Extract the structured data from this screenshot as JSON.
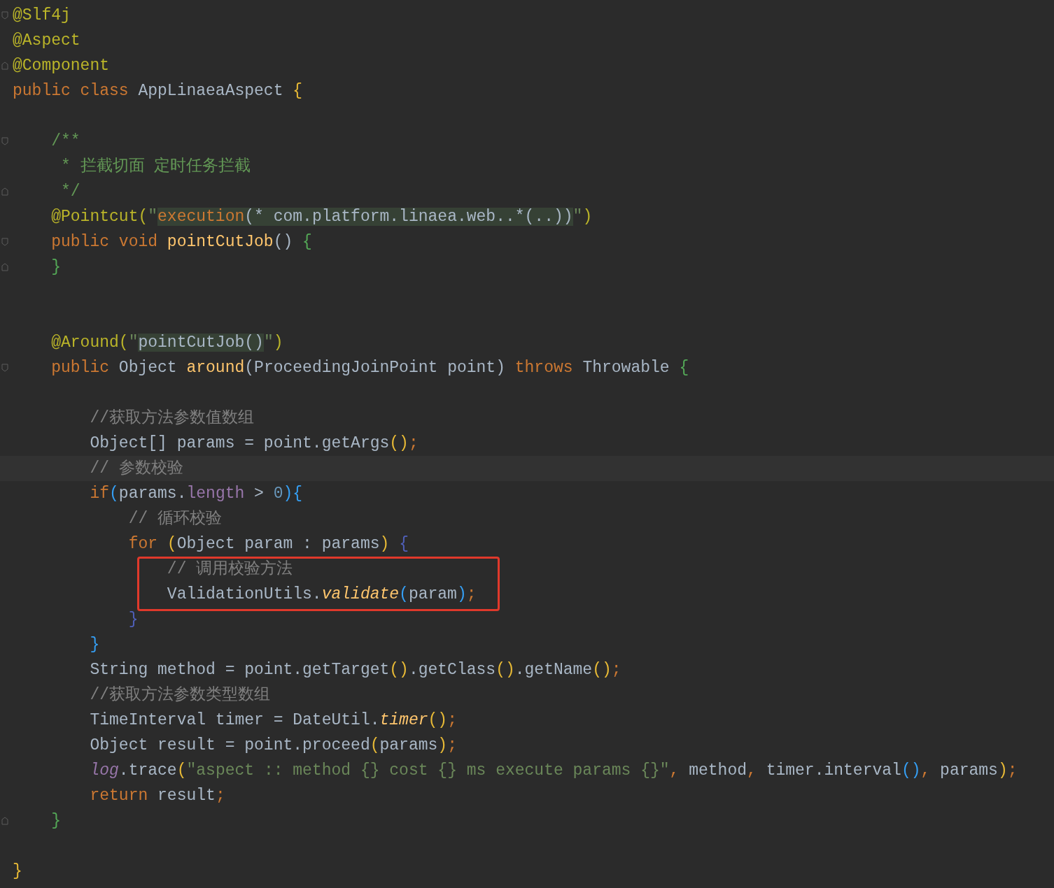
{
  "editor": {
    "lines": [
      {
        "kind": "code",
        "fold_start": true,
        "tokens": [
          {
            "text": "@Slf4j",
            "kind": "annotation"
          }
        ]
      },
      {
        "kind": "code",
        "tokens": [
          {
            "text": "@Aspect",
            "kind": "annotation"
          }
        ]
      },
      {
        "kind": "code",
        "fold_end": true,
        "tokens": [
          {
            "text": "@Component",
            "kind": "annotation"
          }
        ]
      },
      {
        "kind": "code",
        "tokens": [
          {
            "text": "public class ",
            "kind": "keyword"
          },
          {
            "text": "AppLinaeaAspect ",
            "kind": "plain"
          },
          {
            "text": "{",
            "kind": "b1"
          }
        ]
      },
      {
        "kind": "blank"
      },
      {
        "kind": "code",
        "fold_start": true,
        "tokens": [
          {
            "text": "    /**",
            "kind": "doc"
          }
        ]
      },
      {
        "kind": "code",
        "tokens": [
          {
            "text": "     * 拦截切面 定时任务拦截",
            "kind": "doc"
          }
        ]
      },
      {
        "kind": "code",
        "fold_end": true,
        "tokens": [
          {
            "text": "     */",
            "kind": "doc"
          }
        ]
      },
      {
        "kind": "code",
        "tokens": [
          {
            "text": "    @Pointcut(",
            "kind": "annotation"
          },
          {
            "text": "\"",
            "kind": "string"
          },
          {
            "text": "execution",
            "kind": "injected_keyword"
          },
          {
            "text": "(* com.platform.linaea.web..*(..))",
            "kind": "injected"
          },
          {
            "text": "\"",
            "kind": "string"
          },
          {
            "text": ")",
            "kind": "annotation"
          }
        ]
      },
      {
        "kind": "code",
        "fold_start": true,
        "tokens": [
          {
            "text": "    public void ",
            "kind": "keyword"
          },
          {
            "text": "pointCutJob",
            "kind": "declaration"
          },
          {
            "text": "() ",
            "kind": "plain"
          },
          {
            "text": "{",
            "kind": "b2"
          }
        ]
      },
      {
        "kind": "code",
        "fold_end": true,
        "tokens": [
          {
            "text": "    }",
            "kind": "b2"
          }
        ]
      },
      {
        "kind": "blank"
      },
      {
        "kind": "blank"
      },
      {
        "kind": "code",
        "tokens": [
          {
            "text": "    @Around(",
            "kind": "annotation"
          },
          {
            "text": "\"",
            "kind": "string"
          },
          {
            "text": "pointCutJob()",
            "kind": "injected"
          },
          {
            "text": "\"",
            "kind": "string"
          },
          {
            "text": ")",
            "kind": "annotation"
          }
        ]
      },
      {
        "kind": "code",
        "fold_start": true,
        "tokens": [
          {
            "text": "    public ",
            "kind": "keyword"
          },
          {
            "text": "Object ",
            "kind": "plain"
          },
          {
            "text": "around",
            "kind": "declaration"
          },
          {
            "text": "(ProceedingJoinPoint point) ",
            "kind": "plain"
          },
          {
            "text": "throws ",
            "kind": "keyword"
          },
          {
            "text": "Throwable ",
            "kind": "plain"
          },
          {
            "text": "{",
            "kind": "b2"
          }
        ]
      },
      {
        "kind": "blank"
      },
      {
        "kind": "code",
        "tokens": [
          {
            "text": "        //获取方法参数值数组",
            "kind": "comment"
          }
        ]
      },
      {
        "kind": "code",
        "tokens": [
          {
            "text": "        Object[] params = point.getArgs",
            "kind": "plain"
          },
          {
            "text": "()",
            "kind": "b1"
          },
          {
            "text": ";",
            "kind": "keyword"
          }
        ]
      },
      {
        "kind": "code",
        "current": true,
        "tokens": [
          {
            "text": "        // 参数校验",
            "kind": "comment"
          }
        ]
      },
      {
        "kind": "code",
        "tokens": [
          {
            "text": "        if",
            "kind": "keyword"
          },
          {
            "text": "(",
            "kind": "b3"
          },
          {
            "text": "params.",
            "kind": "plain"
          },
          {
            "text": "length",
            "kind": "field"
          },
          {
            "text": " > ",
            "kind": "plain"
          },
          {
            "text": "0",
            "kind": "number"
          },
          {
            "text": "){",
            "kind": "b3"
          }
        ]
      },
      {
        "kind": "code",
        "tokens": [
          {
            "text": "            // 循环校验",
            "kind": "comment"
          }
        ]
      },
      {
        "kind": "code",
        "tokens": [
          {
            "text": "            for ",
            "kind": "keyword"
          },
          {
            "text": "(",
            "kind": "b1"
          },
          {
            "text": "Object param : params",
            "kind": "plain"
          },
          {
            "text": ") ",
            "kind": "b1"
          },
          {
            "text": "{",
            "kind": "b4"
          }
        ]
      },
      {
        "kind": "code",
        "boxed": true,
        "tokens": [
          {
            "text": "                // 调用校验方法",
            "kind": "comment"
          }
        ]
      },
      {
        "kind": "code",
        "boxed": true,
        "tokens": [
          {
            "text": "                ValidationUtils.",
            "kind": "plain"
          },
          {
            "text": "validate",
            "kind": "static"
          },
          {
            "text": "(",
            "kind": "b3"
          },
          {
            "text": "param",
            "kind": "plain"
          },
          {
            "text": ")",
            "kind": "b3"
          },
          {
            "text": ";",
            "kind": "keyword"
          }
        ]
      },
      {
        "kind": "code",
        "tokens": [
          {
            "text": "            }",
            "kind": "b4"
          }
        ]
      },
      {
        "kind": "code",
        "tokens": [
          {
            "text": "        }",
            "kind": "b3"
          }
        ]
      },
      {
        "kind": "code",
        "tokens": [
          {
            "text": "        String method = point.getTarget",
            "kind": "plain"
          },
          {
            "text": "()",
            "kind": "b1"
          },
          {
            "text": ".getClass",
            "kind": "plain"
          },
          {
            "text": "()",
            "kind": "b1"
          },
          {
            "text": ".getName",
            "kind": "plain"
          },
          {
            "text": "()",
            "kind": "b1"
          },
          {
            "text": ";",
            "kind": "keyword"
          }
        ]
      },
      {
        "kind": "code",
        "tokens": [
          {
            "text": "        //获取方法参数类型数组",
            "kind": "comment"
          }
        ]
      },
      {
        "kind": "code",
        "tokens": [
          {
            "text": "        TimeInterval timer = DateUtil.",
            "kind": "plain"
          },
          {
            "text": "timer",
            "kind": "static"
          },
          {
            "text": "()",
            "kind": "b1"
          },
          {
            "text": ";",
            "kind": "keyword"
          }
        ]
      },
      {
        "kind": "code",
        "tokens": [
          {
            "text": "        Object result = point.proceed",
            "kind": "plain"
          },
          {
            "text": "(",
            "kind": "b1"
          },
          {
            "text": "params",
            "kind": "plain"
          },
          {
            "text": ")",
            "kind": "b1"
          },
          {
            "text": ";",
            "kind": "keyword"
          }
        ]
      },
      {
        "kind": "code",
        "tokens": [
          {
            "text": "        log",
            "kind": "static_field"
          },
          {
            "text": ".trace",
            "kind": "plain"
          },
          {
            "text": "(",
            "kind": "b1"
          },
          {
            "text": "\"aspect :: method {} cost {} ms execute params {}\"",
            "kind": "string"
          },
          {
            "text": ", ",
            "kind": "keyword"
          },
          {
            "text": "method",
            "kind": "plain"
          },
          {
            "text": ", ",
            "kind": "keyword"
          },
          {
            "text": "timer.interval",
            "kind": "plain"
          },
          {
            "text": "()",
            "kind": "b3"
          },
          {
            "text": ", ",
            "kind": "keyword"
          },
          {
            "text": "params",
            "kind": "plain"
          },
          {
            "text": ")",
            "kind": "b1"
          },
          {
            "text": ";",
            "kind": "keyword"
          }
        ]
      },
      {
        "kind": "code",
        "tokens": [
          {
            "text": "        return ",
            "kind": "keyword"
          },
          {
            "text": "result",
            "kind": "plain"
          },
          {
            "text": ";",
            "kind": "keyword"
          }
        ]
      },
      {
        "kind": "code",
        "fold_end": true,
        "tokens": [
          {
            "text": "    }",
            "kind": "b2"
          }
        ]
      },
      {
        "kind": "blank"
      },
      {
        "kind": "code",
        "tokens": [
          {
            "text": "}",
            "kind": "b1"
          }
        ]
      }
    ]
  }
}
